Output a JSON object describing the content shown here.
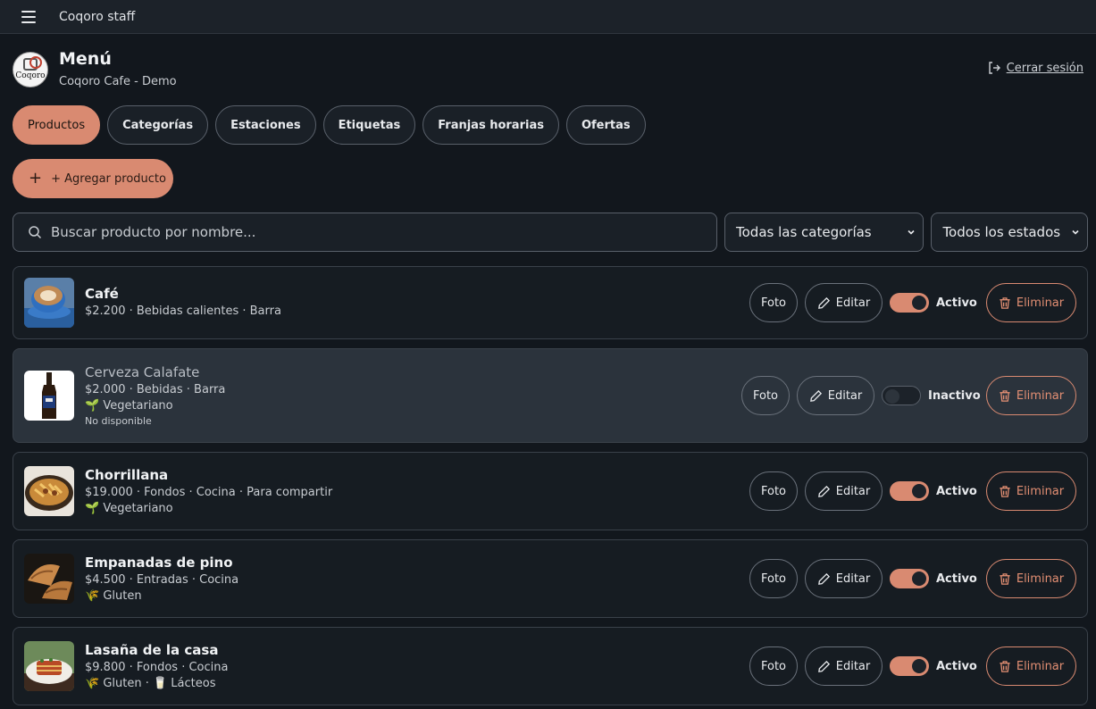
{
  "app": {
    "title": "Coqoro staff"
  },
  "header": {
    "title": "Menú",
    "subtitle": "Coqoro Cafe - Demo",
    "logo_text": "Coqoro",
    "logout_label": "Cerrar sesión"
  },
  "tabs": [
    {
      "label": "Productos",
      "active": true
    },
    {
      "label": "Categorías"
    },
    {
      "label": "Estaciones"
    },
    {
      "label": "Etiquetas"
    },
    {
      "label": "Franjas horarias"
    },
    {
      "label": "Ofertas"
    }
  ],
  "add_button": {
    "label": "+ Agregar producto"
  },
  "search": {
    "placeholder": "Buscar producto por nombre...",
    "value": ""
  },
  "filters": {
    "category": {
      "selected": "Todas las categorías"
    },
    "status": {
      "selected": "Todos los estados"
    }
  },
  "actions": {
    "photo_label": "Foto",
    "edit_label": "Editar",
    "delete_label": "Eliminar"
  },
  "products": [
    {
      "name": "Café",
      "meta": "$2.200 · Bebidas calientes · Barra",
      "tags": "",
      "note": "",
      "status": "Activo",
      "active": true,
      "image_icon": "coffee-cup"
    },
    {
      "name": "Cerveza Calafate",
      "meta": "$2.000 · Bebidas · Barra",
      "tags": "🌱 Vegetariano",
      "note": "No disponible",
      "status": "Inactivo",
      "active": false,
      "image_icon": "beer-bottle"
    },
    {
      "name": "Chorrillana",
      "meta": "$19.000 · Fondos · Cocina · Para compartir",
      "tags": "🌱 Vegetariano",
      "note": "",
      "status": "Activo",
      "active": true,
      "image_icon": "fries-plate"
    },
    {
      "name": "Empanadas de pino",
      "meta": "$4.500 · Entradas · Cocina",
      "tags": "🌾 Gluten",
      "note": "",
      "status": "Activo",
      "active": true,
      "image_icon": "empanadas"
    },
    {
      "name": "Lasaña de la casa",
      "meta": "$9.800 · Fondos · Cocina",
      "tags": "🌾 Gluten · 🥛 Lácteos",
      "note": "",
      "status": "Activo",
      "active": true,
      "image_icon": "lasagna"
    }
  ],
  "colors": {
    "accent": "#d98a71",
    "background": "#12171d",
    "card": "#161c22",
    "card_inactive": "#2b333c"
  }
}
